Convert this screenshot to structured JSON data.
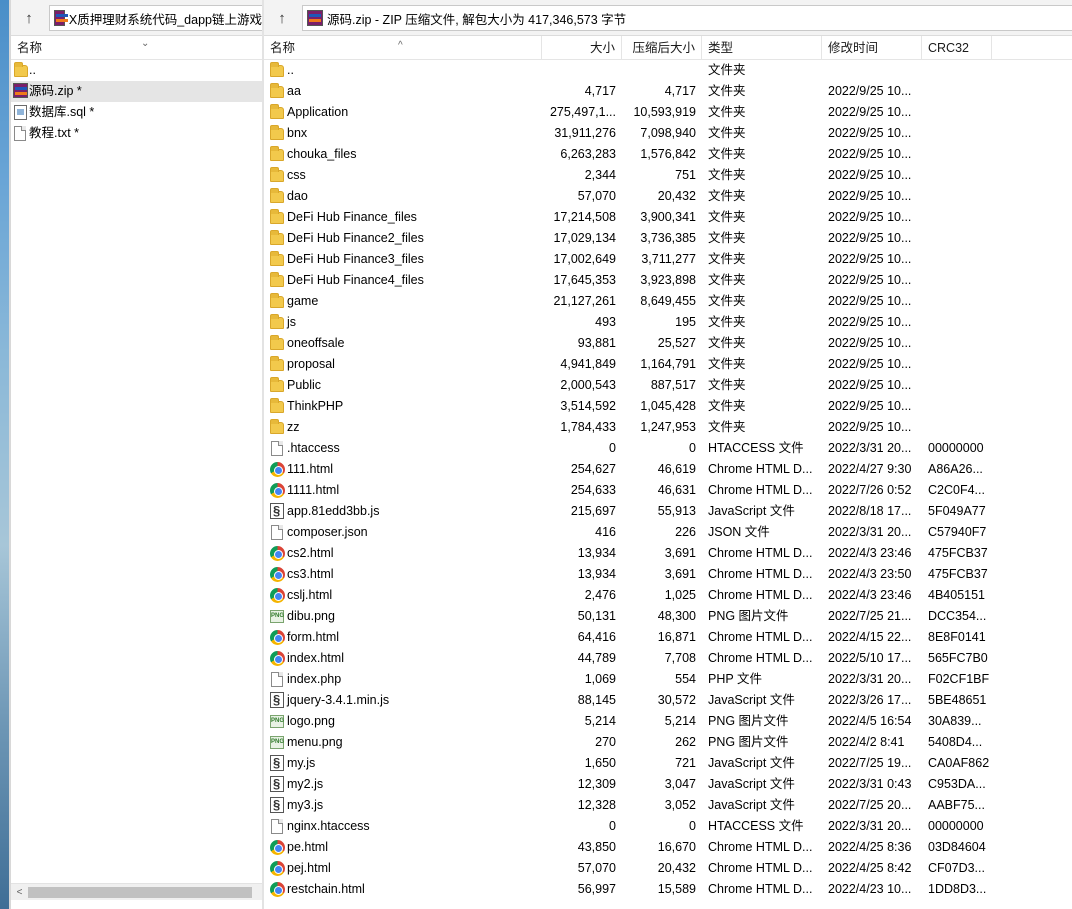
{
  "left": {
    "path": "X质押理财系统代码_dapp链上游戏",
    "col_name": "名称",
    "items": [
      {
        "name": "..",
        "icon": "folder-icon",
        "selected": false
      },
      {
        "name": "源码.zip *",
        "icon": "winrar-icon",
        "selected": true
      },
      {
        "name": "数据库.sql *",
        "icon": "sql-file-icon",
        "selected": false
      },
      {
        "name": "教程.txt *",
        "icon": "text-file-icon",
        "selected": false
      }
    ]
  },
  "right": {
    "path": "源码.zip - ZIP 压缩文件, 解包大小为 417,346,573 字节",
    "columns": {
      "name": "名称",
      "size": "大小",
      "packed": "压缩后大小",
      "type": "类型",
      "modified": "修改时间",
      "crc": "CRC32"
    },
    "files": [
      {
        "name": "..",
        "icon": "folder",
        "size": "",
        "packed": "",
        "type": "文件夹",
        "modified": "",
        "crc": ""
      },
      {
        "name": "aa",
        "icon": "folder",
        "size": "4,717",
        "packed": "4,717",
        "type": "文件夹",
        "modified": "2022/9/25 10...",
        "crc": ""
      },
      {
        "name": "Application",
        "icon": "folder",
        "size": "275,497,1...",
        "packed": "10,593,919",
        "type": "文件夹",
        "modified": "2022/9/25 10...",
        "crc": ""
      },
      {
        "name": "bnx",
        "icon": "folder",
        "size": "31,911,276",
        "packed": "7,098,940",
        "type": "文件夹",
        "modified": "2022/9/25 10...",
        "crc": ""
      },
      {
        "name": "chouka_files",
        "icon": "folder",
        "size": "6,263,283",
        "packed": "1,576,842",
        "type": "文件夹",
        "modified": "2022/9/25 10...",
        "crc": ""
      },
      {
        "name": "css",
        "icon": "folder",
        "size": "2,344",
        "packed": "751",
        "type": "文件夹",
        "modified": "2022/9/25 10...",
        "crc": ""
      },
      {
        "name": "dao",
        "icon": "folder",
        "size": "57,070",
        "packed": "20,432",
        "type": "文件夹",
        "modified": "2022/9/25 10...",
        "crc": ""
      },
      {
        "name": "DeFi Hub Finance_files",
        "icon": "folder",
        "size": "17,214,508",
        "packed": "3,900,341",
        "type": "文件夹",
        "modified": "2022/9/25 10...",
        "crc": ""
      },
      {
        "name": "DeFi Hub Finance2_files",
        "icon": "folder",
        "size": "17,029,134",
        "packed": "3,736,385",
        "type": "文件夹",
        "modified": "2022/9/25 10...",
        "crc": ""
      },
      {
        "name": "DeFi Hub Finance3_files",
        "icon": "folder",
        "size": "17,002,649",
        "packed": "3,711,277",
        "type": "文件夹",
        "modified": "2022/9/25 10...",
        "crc": ""
      },
      {
        "name": "DeFi Hub Finance4_files",
        "icon": "folder",
        "size": "17,645,353",
        "packed": "3,923,898",
        "type": "文件夹",
        "modified": "2022/9/25 10...",
        "crc": ""
      },
      {
        "name": "game",
        "icon": "folder",
        "size": "21,127,261",
        "packed": "8,649,455",
        "type": "文件夹",
        "modified": "2022/9/25 10...",
        "crc": ""
      },
      {
        "name": "js",
        "icon": "folder",
        "size": "493",
        "packed": "195",
        "type": "文件夹",
        "modified": "2022/9/25 10...",
        "crc": ""
      },
      {
        "name": "oneoffsale",
        "icon": "folder",
        "size": "93,881",
        "packed": "25,527",
        "type": "文件夹",
        "modified": "2022/9/25 10...",
        "crc": ""
      },
      {
        "name": "proposal",
        "icon": "folder",
        "size": "4,941,849",
        "packed": "1,164,791",
        "type": "文件夹",
        "modified": "2022/9/25 10...",
        "crc": ""
      },
      {
        "name": "Public",
        "icon": "folder",
        "size": "2,000,543",
        "packed": "887,517",
        "type": "文件夹",
        "modified": "2022/9/25 10...",
        "crc": ""
      },
      {
        "name": "ThinkPHP",
        "icon": "folder",
        "size": "3,514,592",
        "packed": "1,045,428",
        "type": "文件夹",
        "modified": "2022/9/25 10...",
        "crc": ""
      },
      {
        "name": "zz",
        "icon": "folder",
        "size": "1,784,433",
        "packed": "1,247,953",
        "type": "文件夹",
        "modified": "2022/9/25 10...",
        "crc": ""
      },
      {
        "name": ".htaccess",
        "icon": "doc",
        "size": "0",
        "packed": "0",
        "type": "HTACCESS 文件",
        "modified": "2022/3/31 20...",
        "crc": "00000000"
      },
      {
        "name": "111.html",
        "icon": "chrome",
        "size": "254,627",
        "packed": "46,619",
        "type": "Chrome HTML D...",
        "modified": "2022/4/27 9:30",
        "crc": "A86A26..."
      },
      {
        "name": "1111.html",
        "icon": "chrome",
        "size": "254,633",
        "packed": "46,631",
        "type": "Chrome HTML D...",
        "modified": "2022/7/26 0:52",
        "crc": "C2C0F4..."
      },
      {
        "name": "app.81edd3bb.js",
        "icon": "js",
        "size": "215,697",
        "packed": "55,913",
        "type": "JavaScript 文件",
        "modified": "2022/8/18 17...",
        "crc": "5F049A77"
      },
      {
        "name": "composer.json",
        "icon": "doc",
        "size": "416",
        "packed": "226",
        "type": "JSON 文件",
        "modified": "2022/3/31 20...",
        "crc": "C57940F7"
      },
      {
        "name": "cs2.html",
        "icon": "chrome",
        "size": "13,934",
        "packed": "3,691",
        "type": "Chrome HTML D...",
        "modified": "2022/4/3 23:46",
        "crc": "475FCB37"
      },
      {
        "name": "cs3.html",
        "icon": "chrome",
        "size": "13,934",
        "packed": "3,691",
        "type": "Chrome HTML D...",
        "modified": "2022/4/3 23:50",
        "crc": "475FCB37"
      },
      {
        "name": "cslj.html",
        "icon": "chrome",
        "size": "2,476",
        "packed": "1,025",
        "type": "Chrome HTML D...",
        "modified": "2022/4/3 23:46",
        "crc": "4B405151"
      },
      {
        "name": "dibu.png",
        "icon": "png",
        "size": "50,131",
        "packed": "48,300",
        "type": "PNG 图片文件",
        "modified": "2022/7/25 21...",
        "crc": "DCC354..."
      },
      {
        "name": "form.html",
        "icon": "chrome",
        "size": "64,416",
        "packed": "16,871",
        "type": "Chrome HTML D...",
        "modified": "2022/4/15 22...",
        "crc": "8E8F0141"
      },
      {
        "name": "index.html",
        "icon": "chrome",
        "size": "44,789",
        "packed": "7,708",
        "type": "Chrome HTML D...",
        "modified": "2022/5/10 17...",
        "crc": "565FC7B0"
      },
      {
        "name": "index.php",
        "icon": "doc",
        "size": "1,069",
        "packed": "554",
        "type": "PHP 文件",
        "modified": "2022/3/31 20...",
        "crc": "F02CF1BF"
      },
      {
        "name": "jquery-3.4.1.min.js",
        "icon": "js",
        "size": "88,145",
        "packed": "30,572",
        "type": "JavaScript 文件",
        "modified": "2022/3/26 17...",
        "crc": "5BE48651"
      },
      {
        "name": "logo.png",
        "icon": "png",
        "size": "5,214",
        "packed": "5,214",
        "type": "PNG 图片文件",
        "modified": "2022/4/5 16:54",
        "crc": "30A839..."
      },
      {
        "name": "menu.png",
        "icon": "png",
        "size": "270",
        "packed": "262",
        "type": "PNG 图片文件",
        "modified": "2022/4/2 8:41",
        "crc": "5408D4..."
      },
      {
        "name": "my.js",
        "icon": "js",
        "size": "1,650",
        "packed": "721",
        "type": "JavaScript 文件",
        "modified": "2022/7/25 19...",
        "crc": "CA0AF862"
      },
      {
        "name": "my2.js",
        "icon": "js",
        "size": "12,309",
        "packed": "3,047",
        "type": "JavaScript 文件",
        "modified": "2022/3/31 0:43",
        "crc": "C953DA..."
      },
      {
        "name": "my3.js",
        "icon": "js",
        "size": "12,328",
        "packed": "3,052",
        "type": "JavaScript 文件",
        "modified": "2022/7/25 20...",
        "crc": "AABF75..."
      },
      {
        "name": "nginx.htaccess",
        "icon": "doc",
        "size": "0",
        "packed": "0",
        "type": "HTACCESS 文件",
        "modified": "2022/3/31 20...",
        "crc": "00000000"
      },
      {
        "name": "pe.html",
        "icon": "chrome",
        "size": "43,850",
        "packed": "16,670",
        "type": "Chrome HTML D...",
        "modified": "2022/4/25 8:36",
        "crc": "03D84604"
      },
      {
        "name": "pej.html",
        "icon": "chrome",
        "size": "57,070",
        "packed": "20,432",
        "type": "Chrome HTML D...",
        "modified": "2022/4/25 8:42",
        "crc": "CF07D3..."
      },
      {
        "name": "restchain.html",
        "icon": "chrome",
        "size": "56,997",
        "packed": "15,589",
        "type": "Chrome HTML D...",
        "modified": "2022/4/23 10...",
        "crc": "1DD8D3..."
      }
    ]
  }
}
